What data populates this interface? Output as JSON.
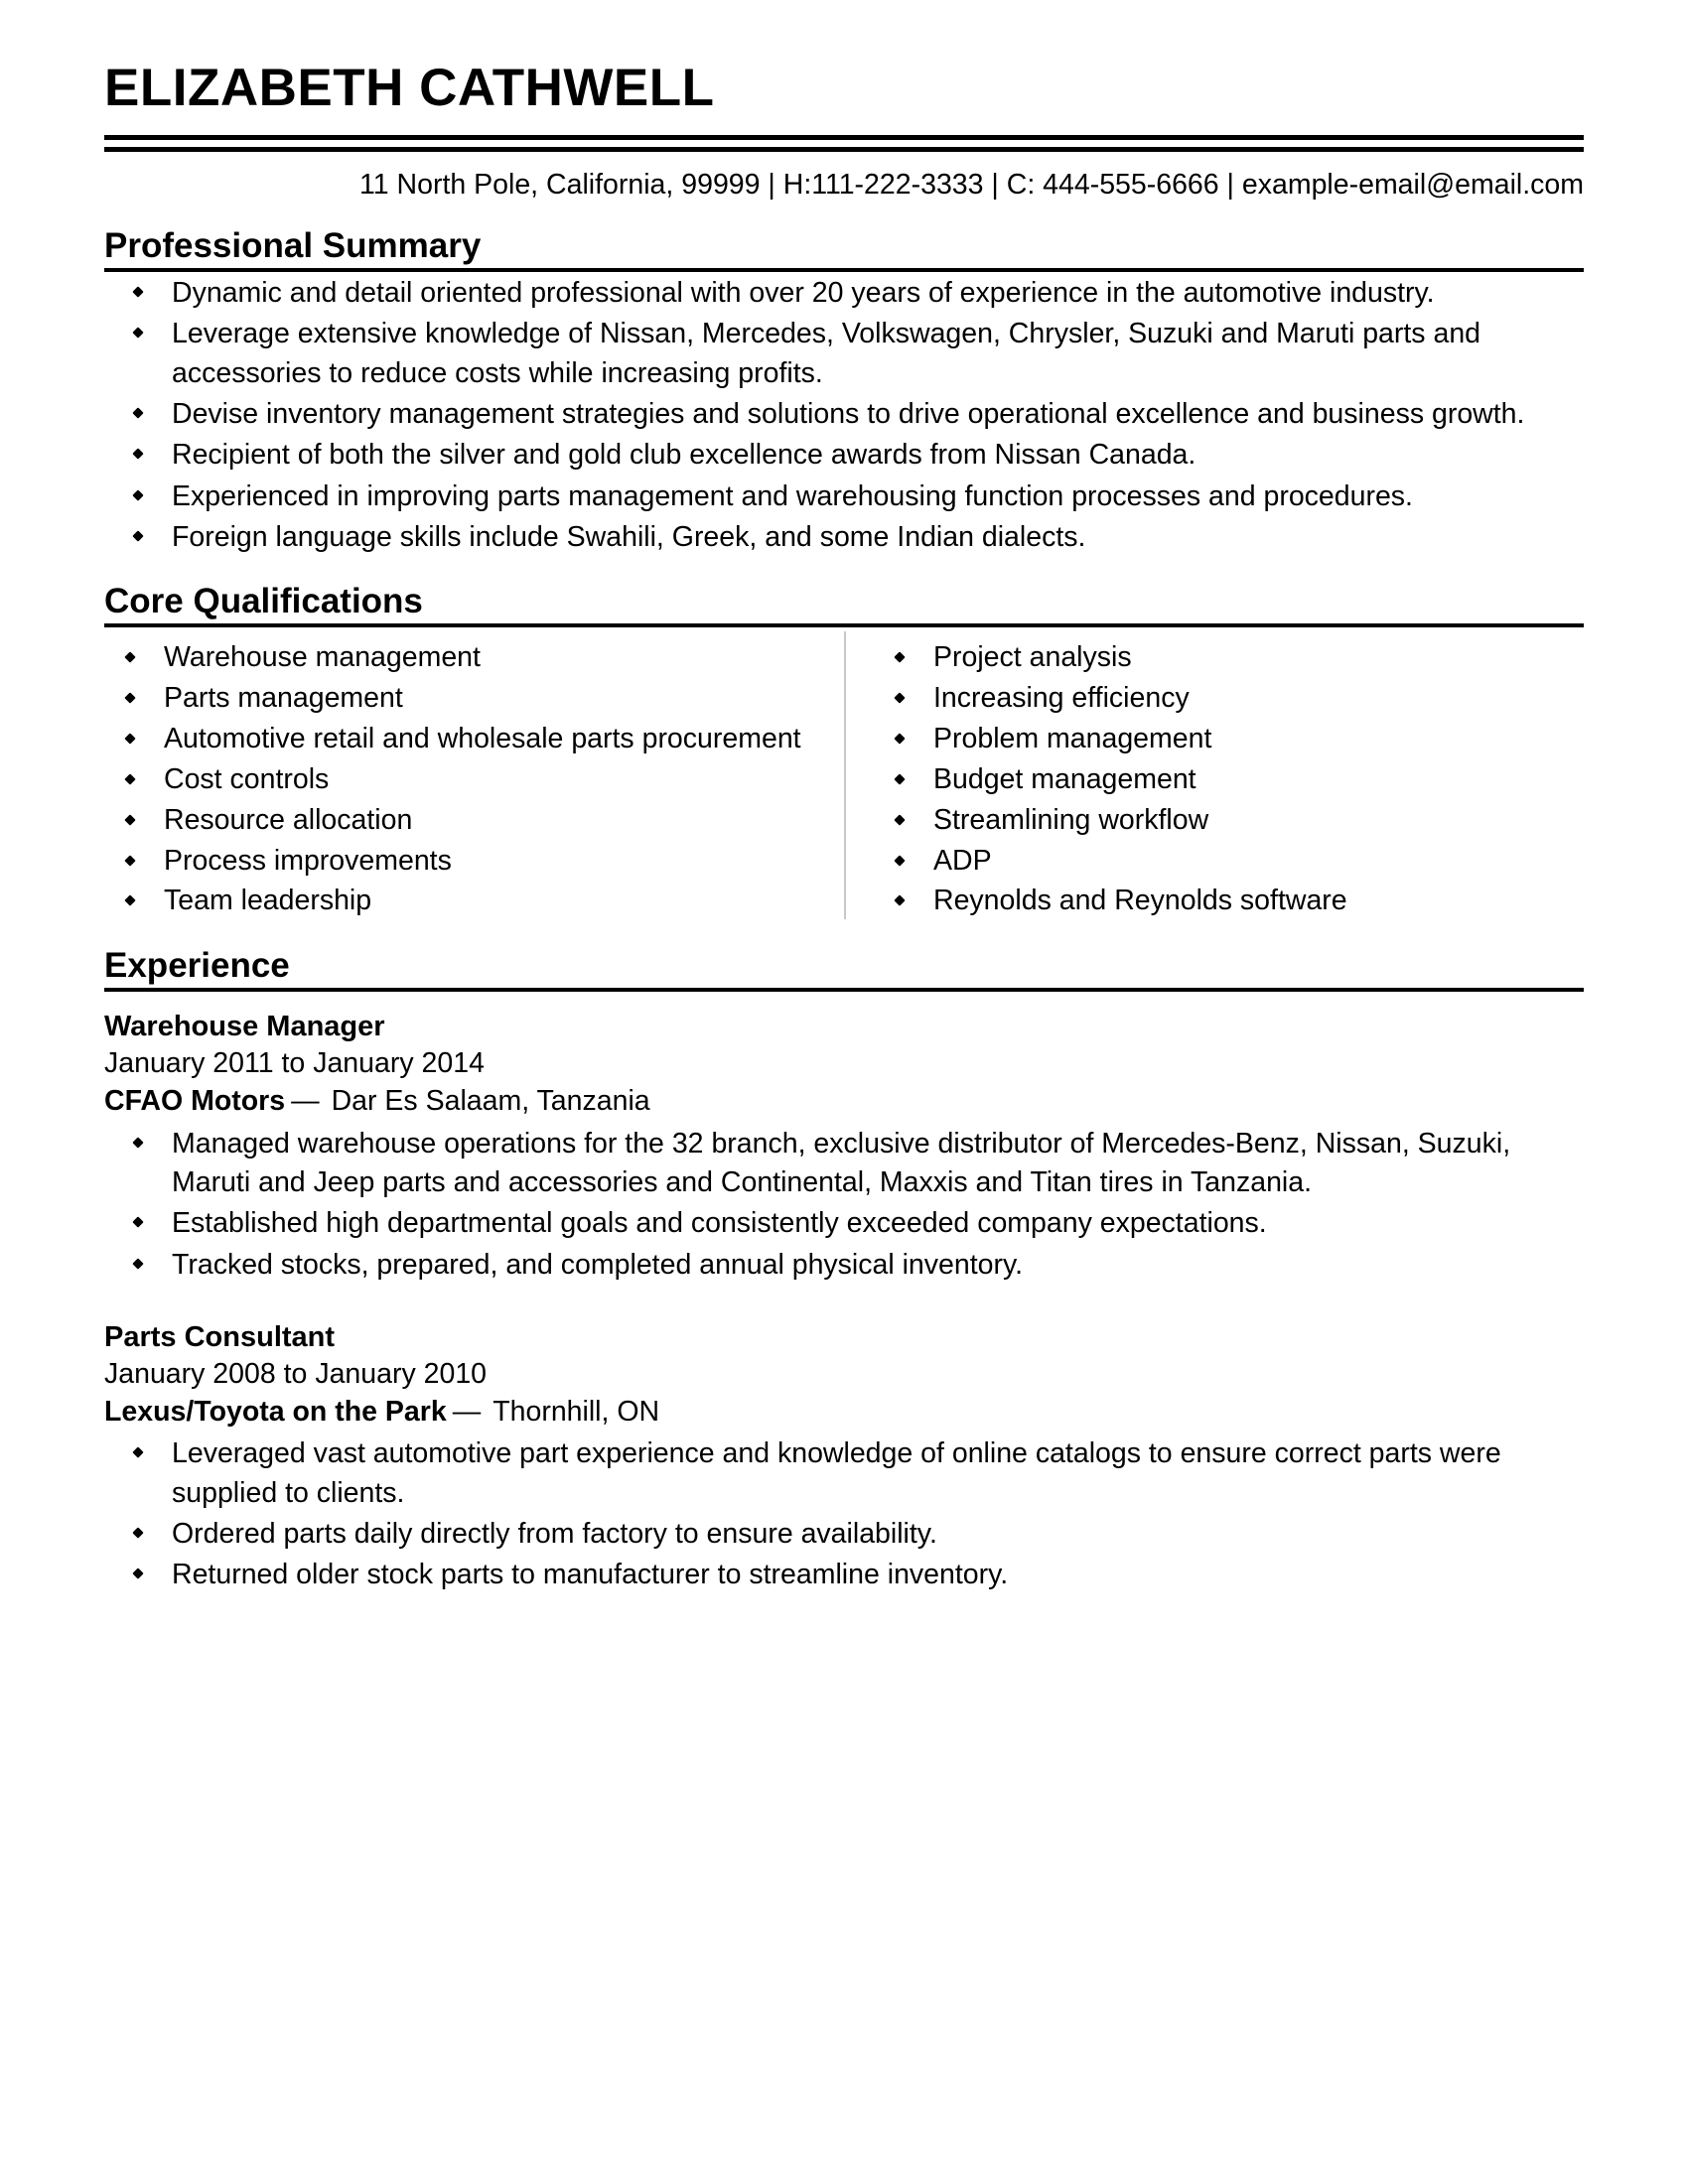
{
  "header": {
    "full_name": "ELIZABETH CATHWELL",
    "contact_line": "11 North Pole, California, 99999 | H:111-222-3333 | C: 444-555-6666 | example-email@email.com"
  },
  "sections": {
    "summary": {
      "heading": "Professional Summary",
      "bullets": [
        "Dynamic and detail oriented professional with over 20 years of experience in the automotive industry.",
        "Leverage extensive knowledge of Nissan, Mercedes, Volkswagen, Chrysler, Suzuki and Maruti parts and accessories to reduce costs while increasing profits.",
        "Devise inventory management strategies and solutions to drive operational excellence and business growth.",
        "Recipient of both the silver and gold club excellence awards from Nissan Canada.",
        "Experienced in improving parts management and warehousing function processes and procedures.",
        "Foreign language skills include Swahili, Greek, and some Indian dialects."
      ]
    },
    "qualifications": {
      "heading": "Core Qualifications",
      "left_column": [
        "Warehouse management",
        "Parts management",
        "Automotive retail and wholesale parts procurement",
        "Cost controls",
        "Resource allocation",
        "Process improvements",
        "Team leadership"
      ],
      "right_column": [
        "Project analysis",
        "Increasing efficiency",
        "Problem management",
        "Budget management",
        "Streamlining workflow",
        "ADP",
        "Reynolds and Reynolds software"
      ]
    },
    "experience": {
      "heading": "Experience",
      "jobs": [
        {
          "title": "Warehouse Manager",
          "dates": "January 2011 to January 2014",
          "company": "CFAO Motors",
          "dash": "—",
          "location": "Dar Es Salaam, Tanzania",
          "bullets": [
            "Managed warehouse operations for the 32 branch, exclusive distributor of Mercedes-Benz, Nissan, Suzuki, Maruti and Jeep parts and accessories and Continental, Maxxis and Titan tires in Tanzania.",
            "Established high departmental goals and consistently exceeded company expectations.",
            "Tracked stocks, prepared, and completed annual physical inventory."
          ]
        },
        {
          "title": "Parts Consultant",
          "dates": "January 2008 to January 2010",
          "company": "Lexus/Toyota on the Park",
          "dash": "—",
          "location": "Thornhill, ON",
          "bullets": [
            "Leveraged vast automotive part experience and knowledge of online catalogs to ensure correct parts were supplied to clients.",
            "Ordered parts daily directly from factory to ensure availability.",
            "Returned older stock parts to manufacturer to streamline inventory."
          ]
        }
      ]
    }
  }
}
